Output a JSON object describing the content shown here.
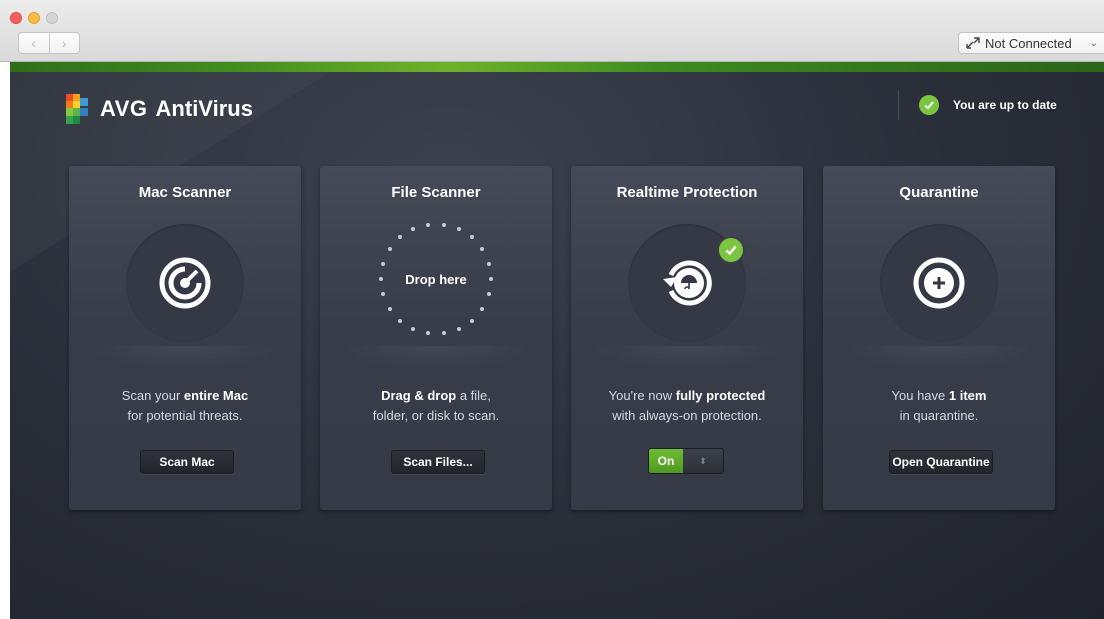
{
  "window": {
    "back_icon": "‹",
    "forward_icon": "›",
    "connection": {
      "label": "Not Connected",
      "icon": "network-arrow-icon",
      "chevron": "⌄"
    }
  },
  "header": {
    "logo_text": "AVG",
    "app_name": "AntiVirus",
    "status_text": "You are up to date",
    "status_color": "#7cc540"
  },
  "cards": [
    {
      "title": "Mac Scanner",
      "desc_line1_pre": "Scan your ",
      "desc_line1_bold": "entire Mac",
      "desc_line2": "for potential threats.",
      "button": "Scan Mac"
    },
    {
      "title": "File Scanner",
      "drop_label": "Drop here",
      "desc_line1_bold": "Drag & drop",
      "desc_line1_post": " a file,",
      "desc_line2": "folder, or disk to scan.",
      "button": "Scan Files..."
    },
    {
      "title": "Realtime Protection",
      "desc_line1_pre": "You're now ",
      "desc_line1_bold": "fully protected",
      "desc_line2": "with always-on protection.",
      "toggle_on": "On",
      "toggle_knob": "⬍"
    },
    {
      "title": "Quarantine",
      "desc_line1_pre": "You have ",
      "desc_line1_bold": "1 item",
      "desc_line2": "in quarantine.",
      "button": "Open Quarantine"
    }
  ],
  "colors": {
    "accent_green": "#7cc540",
    "background": "#2a2e39",
    "card": "#3d4150"
  }
}
